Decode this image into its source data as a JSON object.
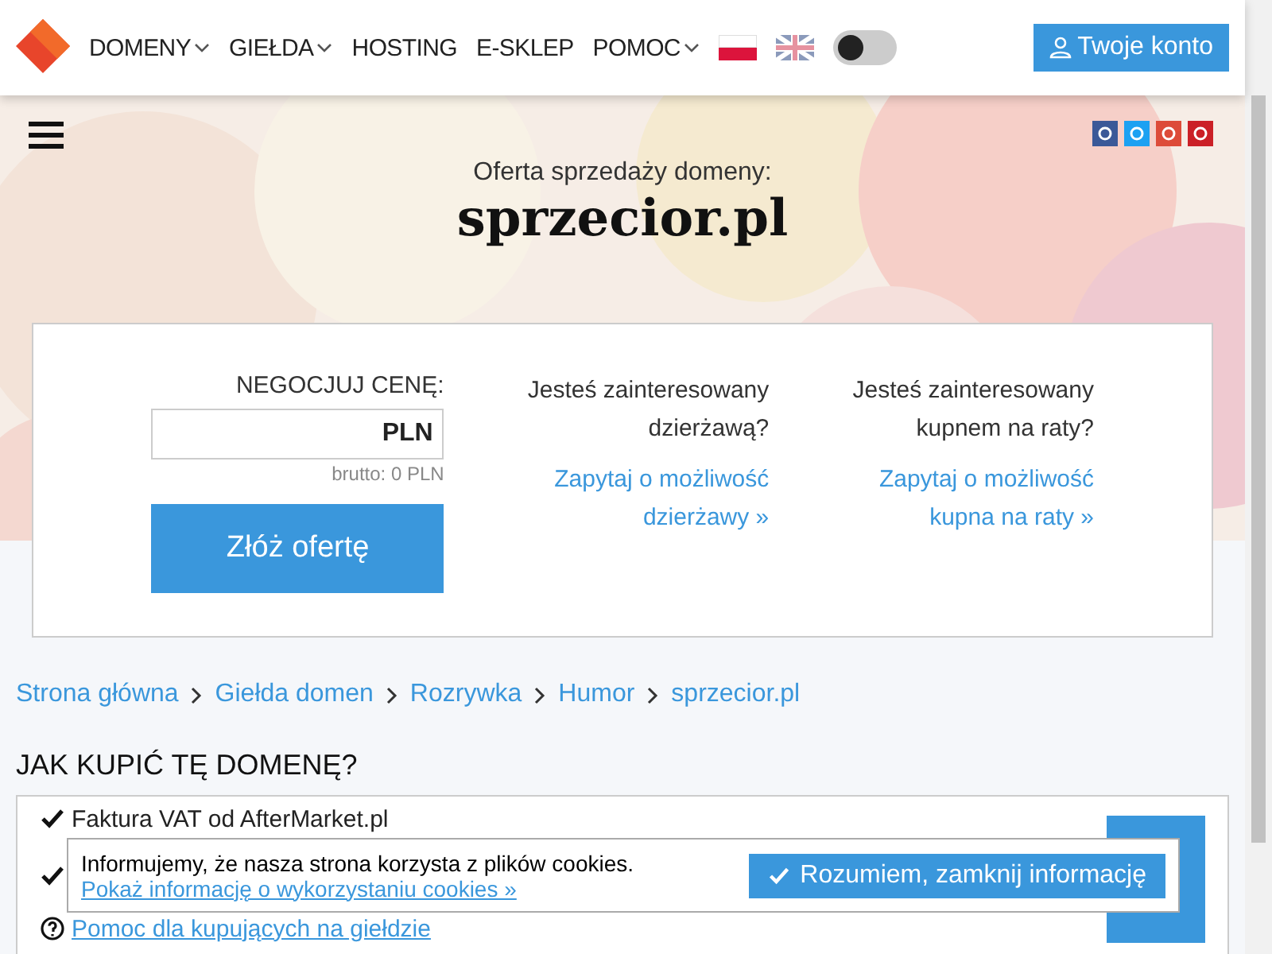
{
  "header": {
    "nav": [
      {
        "label": "DOMENY",
        "dropdown": true
      },
      {
        "label": "GIEŁDA",
        "dropdown": true
      },
      {
        "label": "HOSTING",
        "dropdown": false
      },
      {
        "label": "E-SKLEP",
        "dropdown": false
      },
      {
        "label": "POMOC",
        "dropdown": true
      }
    ],
    "languages": [
      {
        "kind": "pl",
        "selected": true
      },
      {
        "kind": "en",
        "selected": false
      }
    ],
    "dark_mode": {
      "on": false
    },
    "account_button": "Twoje konto"
  },
  "hero": {
    "subtitle": "Oferta sprzedaży domeny:",
    "domain": "sprzecior.pl",
    "social": [
      {
        "kind": "facebook"
      },
      {
        "kind": "twitter"
      },
      {
        "kind": "googleplus"
      },
      {
        "kind": "pinterest"
      }
    ]
  },
  "offer": {
    "label": "NEGOCJUJ CENĘ:",
    "currency": "PLN",
    "gross": "brutto: 0 PLN",
    "submit": "Złóż ofertę",
    "columns": [
      {
        "question": "Jesteś zainteresowany dzierżawą?",
        "link": "Zapytaj o możliwość dzierżawy »"
      },
      {
        "question": "Jesteś zainteresowany kupnem na raty?",
        "link": "Zapytaj o możliwość kupna na raty »"
      }
    ]
  },
  "breadcrumbs": [
    "Strona główna",
    "Giełda domen",
    "Rozrywka",
    "Humor",
    "sprzecior.pl"
  ],
  "how_to_buy": {
    "title": "JAK KUPIĆ TĘ DOMENĘ?",
    "items": [
      {
        "kind": "check",
        "text": "Faktura VAT od AfterMarket.pl"
      },
      {
        "kind": "check"
      },
      {
        "kind": "help",
        "text": "Pomoc dla kupujących na giełdzie"
      }
    ]
  },
  "cookie_notice": {
    "text": "Informujemy, że nasza strona korzysta z plików cookies.",
    "link": "Pokaż informację o wykorzystaniu cookies »",
    "button": "Rozumiem, zamknij informację"
  }
}
